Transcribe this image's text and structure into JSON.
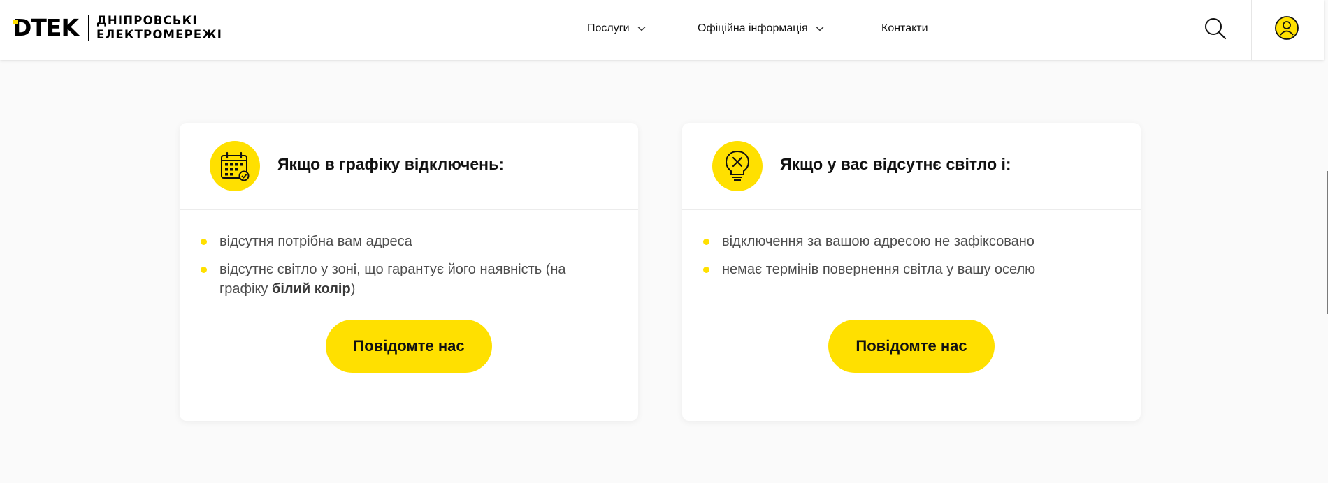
{
  "header": {
    "logo_mark": "DTEK",
    "logo_sub_line1": "ДНІПРОВСЬКІ",
    "logo_sub_line2": "ЕЛЕКТРОМЕРЕЖІ",
    "nav": [
      {
        "label": "Послуги",
        "has_dropdown": true
      },
      {
        "label": "Офіційна інформація",
        "has_dropdown": true
      },
      {
        "label": "Контакти",
        "has_dropdown": false
      }
    ],
    "search_icon": "search-icon",
    "account_icon": "user-icon"
  },
  "cards": [
    {
      "icon": "calendar-check-icon",
      "title": "Якщо в графіку відключень:",
      "bullets": [
        {
          "text": "відсутня потрібна вам адреса"
        },
        {
          "text_before": "відсутнє світло у зоні, що гарантує його наявність (на графіку ",
          "bold": "білий колір",
          "text_after": ")"
        }
      ],
      "button_label": "Повідомте нас"
    },
    {
      "icon": "lightbulb-off-icon",
      "title": "Якщо у вас відсутнє світло і:",
      "bullets": [
        {
          "text": "відключення за вашою адресою не зафіксовано"
        },
        {
          "text": "немає термінів повернення світла у вашу оселю"
        }
      ],
      "button_label": "Повідомте нас"
    }
  ],
  "colors": {
    "brand_yellow": "#ffe000",
    "text_dark": "#111111",
    "text_muted": "#4d4d4d",
    "page_bg": "#fafafa"
  }
}
